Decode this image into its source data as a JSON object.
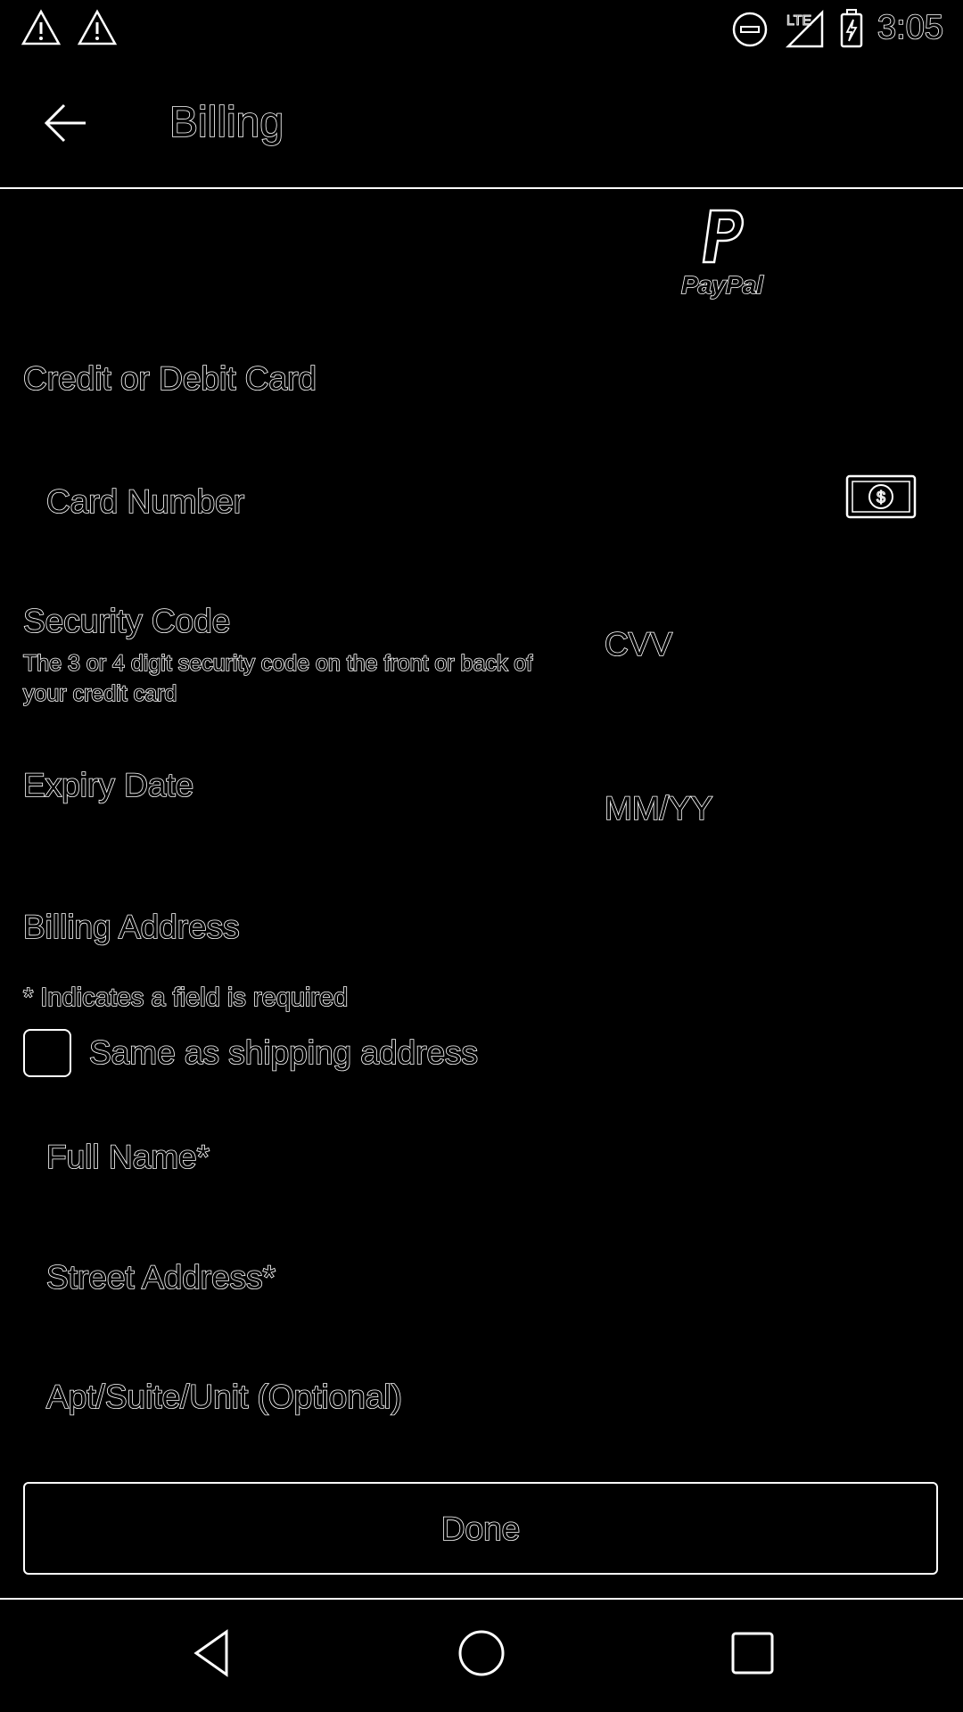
{
  "status_bar": {
    "time": "3:05",
    "network_label": "LTE",
    "icons": [
      "warning-icon",
      "warning-icon",
      "do-not-disturb-icon",
      "lte-signal-icon",
      "battery-charging-icon"
    ]
  },
  "app_bar": {
    "title": "Billing",
    "back_icon": "arrow-back-icon"
  },
  "paypal": {
    "label": "PayPal",
    "icon": "paypal-logo-icon"
  },
  "card_section": {
    "title": "Credit or Debit Card",
    "card_number_placeholder": "Card Number",
    "card_icon": "card-dollar-icon",
    "security_code_title": "Security Code",
    "security_code_hint": "The 3 or 4 digit security code on the front or back of your credit card",
    "cvv_placeholder": "CVV",
    "expiry_title": "Expiry Date",
    "expiry_placeholder": "MM/YY"
  },
  "billing_address": {
    "title": "Billing Address",
    "required_note": "* Indicates a field is required",
    "same_as_shipping_label": "Same as shipping address",
    "same_as_shipping_checked": false,
    "full_name_placeholder": "Full Name*",
    "street_placeholder": "Street Address*",
    "apt_placeholder": "Apt/Suite/Unit (Optional)"
  },
  "done_button": {
    "label": "Done"
  },
  "nav_bar": {
    "icons": [
      "nav-back-icon",
      "nav-home-icon",
      "nav-recents-icon"
    ]
  },
  "colors": {
    "background": "#000000",
    "foreground": "#ffffff"
  }
}
